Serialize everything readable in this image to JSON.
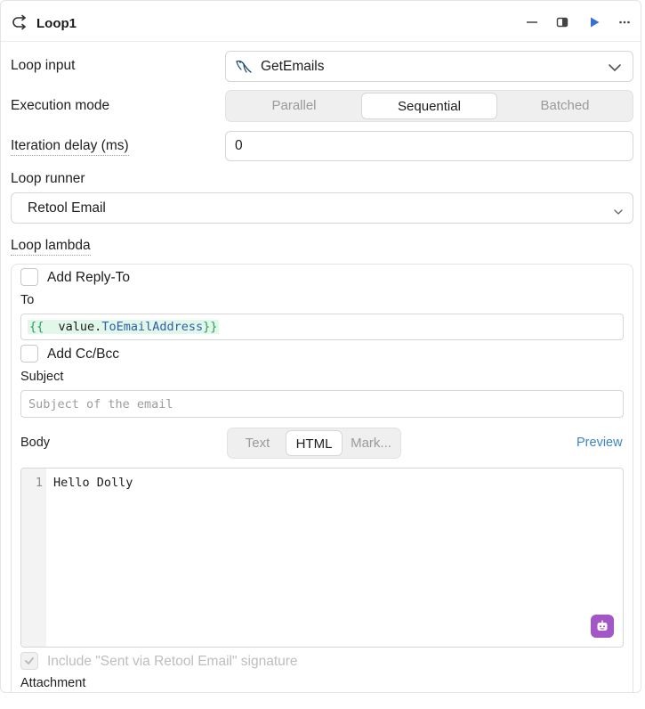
{
  "header": {
    "title": "Loop1",
    "icons": [
      "loop-icon",
      "minimize-icon",
      "sidebar-toggle-icon",
      "run-icon",
      "more-icon"
    ]
  },
  "loop_input": {
    "label": "Loop input",
    "value": "GetEmails",
    "icon": "mysql-icon"
  },
  "execution_mode": {
    "label": "Execution mode",
    "options": [
      "Parallel",
      "Sequential",
      "Batched"
    ],
    "selected": "Sequential"
  },
  "iteration_delay": {
    "label": "Iteration delay (ms)",
    "value": "0"
  },
  "loop_runner": {
    "label": "Loop runner",
    "value": "Retool Email"
  },
  "loop_lambda": {
    "label": "Loop lambda",
    "add_reply_to": "Add Reply-To",
    "to_label": "To",
    "to_value": {
      "open": "{{",
      "var": "value",
      "dot": ".",
      "prop": "ToEmailAddress",
      "close": "}}"
    },
    "add_cc_bcc": "Add Cc/Bcc",
    "subject_label": "Subject",
    "subject_placeholder": "Subject of the email",
    "body_label": "Body",
    "body_tabs": [
      "Text",
      "HTML",
      "Mark..."
    ],
    "body_tab_selected": "HTML",
    "preview_link": "Preview",
    "editor": {
      "line_number": "1",
      "content": "Hello Dolly"
    },
    "signature_label": "Include \"Sent via Retool Email\" signature",
    "signature_checked": true,
    "attachment_label": "Attachment"
  },
  "colors": {
    "accent_blue": "#3b6fd8",
    "preview_link": "#3d84c6",
    "template_green_bg": "#e1f7ea",
    "template_green": "#2a9d5f",
    "template_prop": "#2f5ea8",
    "assistant_purple": "#a357c7"
  }
}
